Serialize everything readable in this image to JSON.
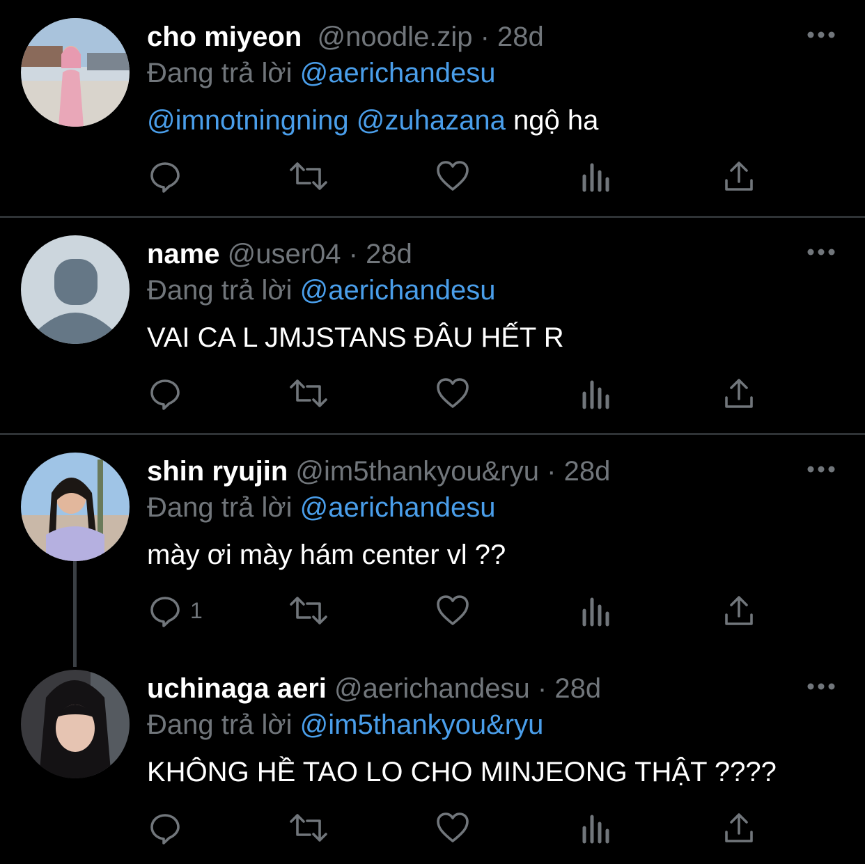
{
  "reply_prefix": "Đang trả lời",
  "tweets": [
    {
      "name": "cho miyeon",
      "handle": "@noodle.zip",
      "separator": "·",
      "time": "28d",
      "reply_to": "@aerichandesu",
      "text_mentions": [
        "@imnotningning",
        "@zuhazana"
      ],
      "text": "ngộ ha",
      "reply_count": "",
      "avatar": "photo"
    },
    {
      "name": "name",
      "handle": "@user04",
      "separator": "·",
      "time": "28d",
      "reply_to": "@aerichandesu",
      "text": "VAI CA L JMJSTANS ĐÂU HẾT R",
      "reply_count": "",
      "avatar": "default-profile"
    },
    {
      "name": "shin ryujin",
      "handle": "@im5thankyou&ryu",
      "separator": "·",
      "time": "28d",
      "reply_to": "@aerichandesu",
      "text": "mày ơi mày hám center vl ??",
      "reply_count": "1",
      "avatar": "photo"
    },
    {
      "name": "uchinaga aeri",
      "handle": "@aerichandesu",
      "separator": "·",
      "time": "28d",
      "reply_to": "@im5thankyou&ryu",
      "text": "KHÔNG HỀ TAO LO CHO MINJEONG THẬT ????",
      "reply_count": "",
      "avatar": "photo"
    }
  ],
  "colors": {
    "background": "#000000",
    "text": "#ffffff",
    "muted": "#71767b",
    "mention": "#4a9eea",
    "divider": "#2f3336"
  }
}
